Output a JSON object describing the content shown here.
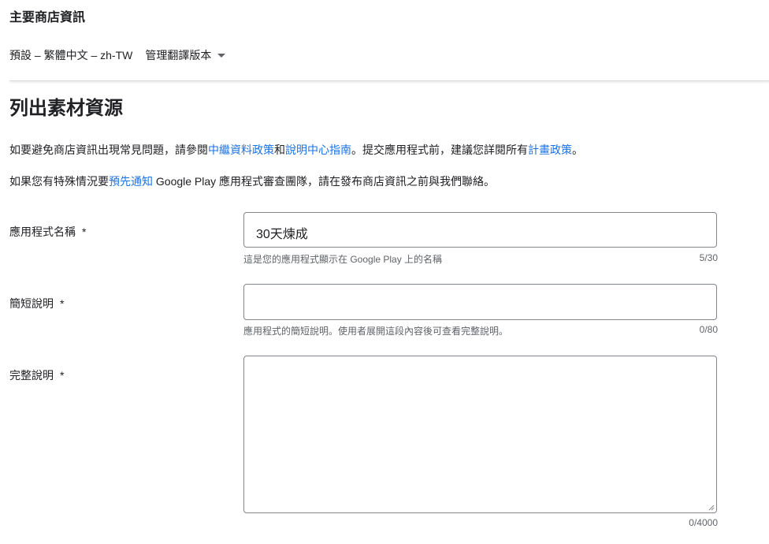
{
  "header": {
    "section_title": "主要商店資訊",
    "language": "預設 – 繁體中文 – zh-TW",
    "manage_translations": "管理翻譯版本"
  },
  "main": {
    "title": "列出素材資源",
    "para1": {
      "text_a": "如要避免商店資訊出現常見問題，請參閱",
      "link_a": "中繼資料政策",
      "text_b": "和",
      "link_b": "說明中心指南",
      "text_c": "。提交應用程式前，建議您詳閱所有",
      "link_c": "計畫政策",
      "text_d": "。"
    },
    "para2": {
      "text_a": "如果您有特殊情況要",
      "link_a": "預先通知",
      "text_b": " Google Play 應用程式審查團隊，請在發布商店資訊之前與我們聯絡。"
    }
  },
  "fields": {
    "app_name": {
      "label": "應用程式名稱",
      "required": "*",
      "value": "30天煉成",
      "helper": "這是您的應用程式顯示在 Google Play 上的名稱",
      "counter": "5/30"
    },
    "short_desc": {
      "label": "簡短說明",
      "required": "*",
      "value": "",
      "helper": "應用程式的簡短說明。使用者展開這段內容後可查看完整說明。",
      "counter": "0/80"
    },
    "full_desc": {
      "label": "完整說明",
      "required": "*",
      "value": "",
      "counter": "0/4000"
    }
  },
  "colors": {
    "link": "#1a73e8",
    "text": "#202124",
    "secondary": "#5f6368",
    "border": "#80868b"
  }
}
